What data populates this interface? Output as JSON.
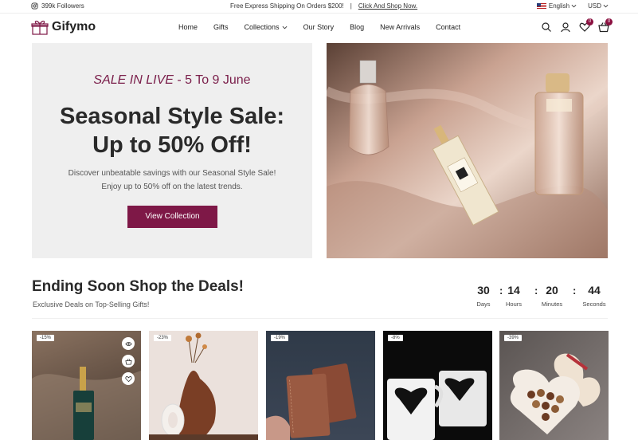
{
  "topbar": {
    "followers": "399k Followers",
    "shipping": "Free Express Shipping On Orders $200!",
    "separator": "|",
    "shop_link": "Click And Shop Now.",
    "language": "English",
    "currency": "USD"
  },
  "header": {
    "logo": "Gifymo",
    "nav": [
      "Home",
      "Gifts",
      "Collections",
      "Our Story",
      "Blog",
      "New Arrivals",
      "Contact"
    ],
    "wishlist_count": "0",
    "cart_count": "0"
  },
  "hero": {
    "sale_tag": "SALE IN LIVE",
    "sale_dates": " - 5 To 9 June",
    "title_line1": "Seasonal Style Sale:",
    "title_line2": "Up to 50% Off!",
    "desc_line1": "Discover unbeatable savings with our Seasonal Style Sale!",
    "desc_line2": "Enjoy up to 50% off on the latest trends.",
    "cta": "View Collection"
  },
  "deals": {
    "title": "Ending Soon Shop the Deals!",
    "subtitle": "Exclusive Deals on Top-Selling Gifts!",
    "countdown": [
      {
        "value": "30",
        "label": "Days"
      },
      {
        "value": "14",
        "label": "Hours"
      },
      {
        "value": "20",
        "label": "Minutes"
      },
      {
        "value": "44",
        "label": "Seconds"
      }
    ]
  },
  "products": [
    {
      "discount": "-15%",
      "image": "perfume-bottle"
    },
    {
      "discount": "-23%",
      "image": "vase-decor"
    },
    {
      "discount": "-19%",
      "image": "leather-wallets"
    },
    {
      "discount": "-8%",
      "image": "heart-mugs"
    },
    {
      "discount": "-39%",
      "image": "chocolate-box"
    }
  ],
  "colors": {
    "accent": "#7e1847",
    "hero_bg": "#efefef",
    "badge": "#8b1040"
  }
}
